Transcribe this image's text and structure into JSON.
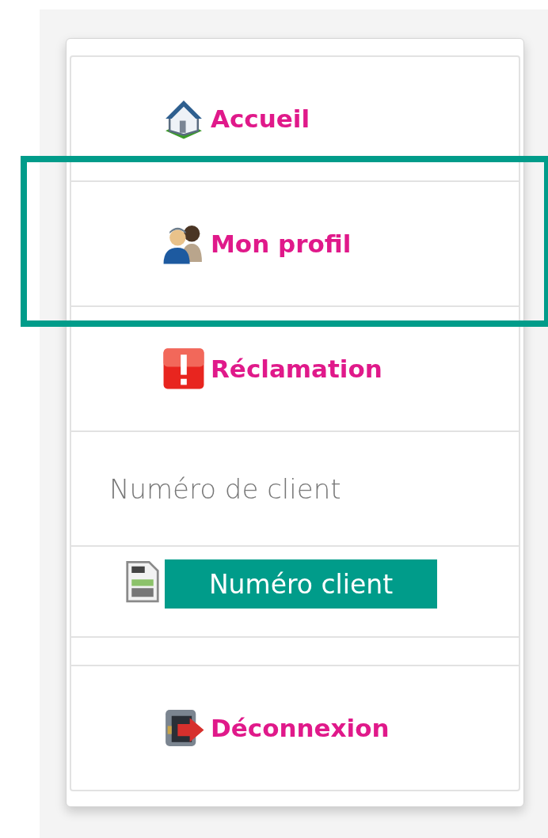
{
  "menu": [
    {
      "kind": "home",
      "label": "Accueil",
      "highlighted": false
    },
    {
      "kind": "profile",
      "label": "Mon profil",
      "highlighted": true
    },
    {
      "kind": "complaint",
      "label": "Réclamation",
      "highlighted": false
    }
  ],
  "client_number": {
    "label": "Numéro de client",
    "placeholder": "Numéro client"
  },
  "logout": {
    "kind": "logout",
    "label": "Déconnexion"
  }
}
